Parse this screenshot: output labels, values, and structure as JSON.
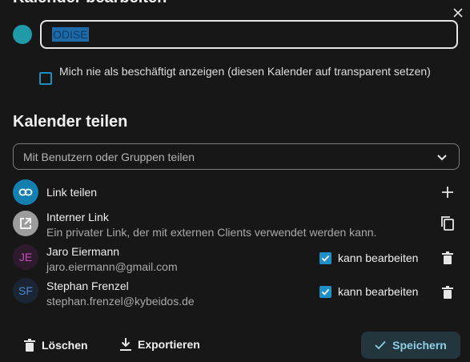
{
  "dialog": {
    "title": "Kalender bearbeiten"
  },
  "calendar": {
    "color": "#1f9aa6",
    "name_value": "ODISE",
    "transparent_label": "Mich nie als beschäftigt anzeigen (diesen Kalender auf transparent setzen)",
    "transparent_checked": false
  },
  "sharing": {
    "title": "Kalender teilen",
    "select_placeholder": "Mit Benutzern oder Gruppen teilen",
    "link_share_label": "Link teilen",
    "internal_link": {
      "title": "Interner Link",
      "description": "Ein privater Link, der mit externen Clients verwendet werden kann."
    },
    "users": [
      {
        "initials": "JE",
        "name": "Jaro Eiermann",
        "email": "jaro.eiermann@gmail.com",
        "permission_label": "kann bearbeiten",
        "can_edit": true,
        "avatar_bg": "#2b1b2d",
        "avatar_fg": "#c44bb5"
      },
      {
        "initials": "SF",
        "name": "Stephan Frenzel",
        "email": "stephan.frenzel@kybeidos.de",
        "permission_label": "kann bearbeiten",
        "can_edit": true,
        "avatar_bg": "#1a2433",
        "avatar_fg": "#4f86cf"
      }
    ]
  },
  "footer": {
    "delete_label": "Löschen",
    "export_label": "Exportieren",
    "save_label": "Speichern"
  },
  "colors": {
    "accent": "#1f8fc7",
    "link_icon_bg": "#1480b0",
    "internal_icon_bg": "#9c9c9c"
  }
}
